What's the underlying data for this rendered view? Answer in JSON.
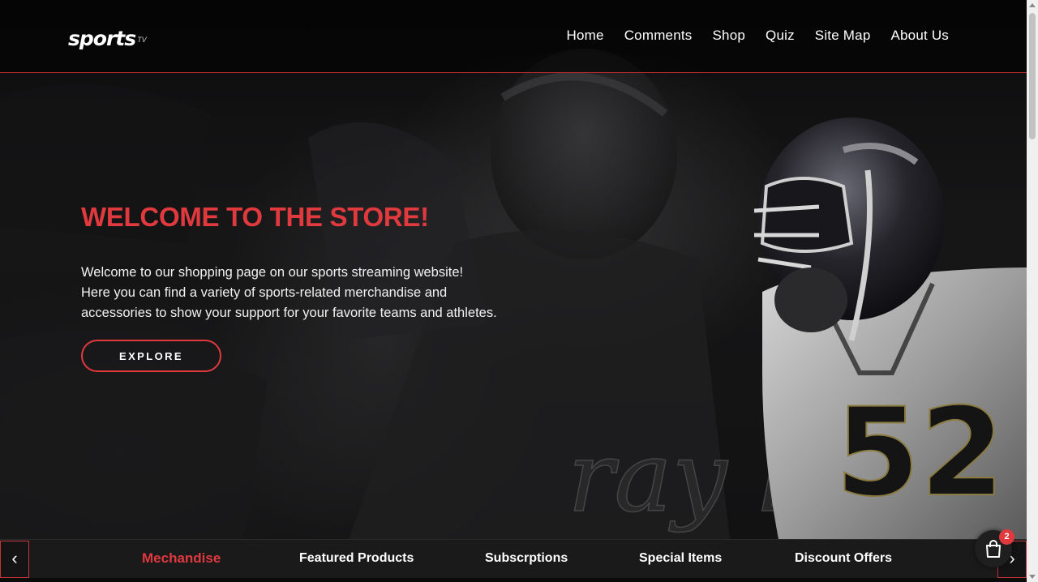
{
  "brand": {
    "name": "sports",
    "suffix": "TV"
  },
  "nav": {
    "items": [
      {
        "label": "Home"
      },
      {
        "label": "Comments"
      },
      {
        "label": "Shop"
      },
      {
        "label": "Quiz"
      },
      {
        "label": "Site Map"
      },
      {
        "label": "About Us"
      }
    ]
  },
  "hero": {
    "title": "WELCOME TO THE STORE!",
    "lines": [
      "Welcome to our shopping page on our sports streaming website!",
      "Here you can find a variety of sports-related merchandise and",
      "accessories to show your support for your favorite teams and athletes."
    ],
    "cta_label": "EXPLORE",
    "jersey_number": "52",
    "signature": "ray lewis"
  },
  "categories": {
    "prev_label": "‹",
    "next_label": "›",
    "items": [
      {
        "label": "Mechandise",
        "active": true
      },
      {
        "label": "Featured Products",
        "active": false
      },
      {
        "label": "Subscrptions",
        "active": false
      },
      {
        "label": "Special Items",
        "active": false
      },
      {
        "label": "Discount Offers",
        "active": false
      }
    ]
  },
  "cart": {
    "count": "2",
    "icon": "shopping-bag-icon"
  },
  "colors": {
    "accent": "#e0393e",
    "background": "#0b0b0c",
    "bar": "#1a1a1b"
  }
}
